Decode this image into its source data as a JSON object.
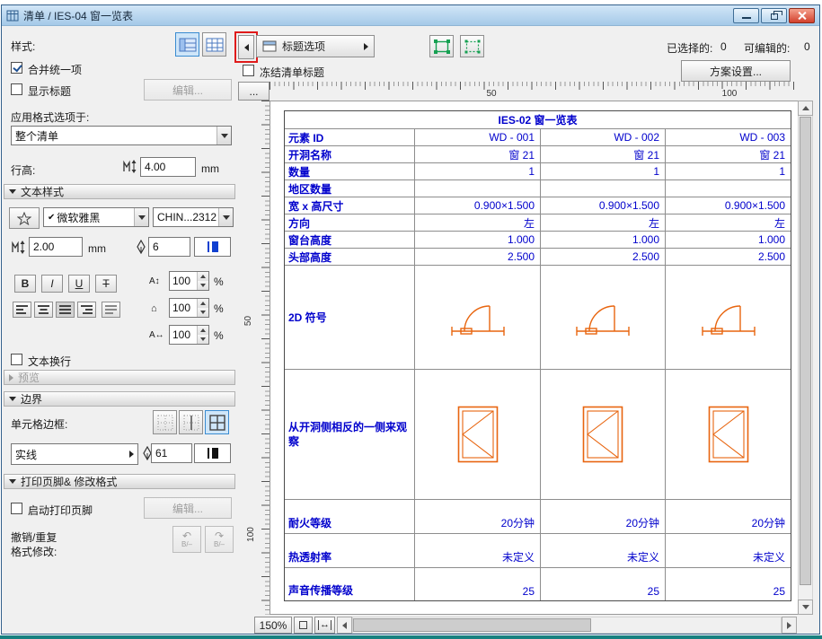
{
  "titlebar": {
    "title": "清单 / IES-04 窗一览表"
  },
  "panel": {
    "style_label": "样式:",
    "merge_uniform": "合并统一项",
    "show_headline": "显示标题",
    "edit": "编辑...",
    "apply_to_label": "应用格式选项于:",
    "apply_to_value": "整个清单",
    "row_height_label": "行高:",
    "row_height_value": "4.00",
    "mm": "mm",
    "sections": {
      "text_style": "文本样式",
      "preview": "预览",
      "border": "边界",
      "print": "打印页脚& 修改格式"
    },
    "font": {
      "check": "✔",
      "name": "微软雅黑",
      "encoding": "CHIN...2312",
      "size": "2.00",
      "pen": "6",
      "bold": "B",
      "italic": "I",
      "underline": "U",
      "strike": "T",
      "line_spacing": "100",
      "width_factor": "100",
      "char_spacing": "100",
      "percent": "%"
    },
    "icons": {
      "line_spacing": "A↕",
      "width_factor": "⌂",
      "char_spacing": "A↔",
      "undo": "↶",
      "redo": "↷",
      "undo_sub": "B/–",
      "redo_sub": "B/–"
    },
    "text_wrap": "文本换行",
    "cell_border_label": "单元格边框:",
    "line_type": "实线",
    "border_pen": "61",
    "enable_print_footer": "启动打印页脚",
    "undo_label": "撤销/重复",
    "format_label": "格式修改:"
  },
  "toolbar": {
    "header_options": "标题选项",
    "selected_label": "已选择的:",
    "selected_value": "0",
    "editable_label": "可编辑的:",
    "editable_value": "0",
    "freeze_header": "冻结清单标题",
    "scheme_settings": "方案设置..."
  },
  "ruler": {
    "corner": "...",
    "h_labels": [
      "50",
      "100"
    ],
    "v_labels": [
      "50",
      "100"
    ]
  },
  "table": {
    "title": "IES-02 窗一览表",
    "rows": [
      {
        "label": "元素 ID",
        "values": [
          "WD - 001",
          "WD - 002",
          "WD - 003"
        ]
      },
      {
        "label": "开洞名称",
        "values": [
          "窗 21",
          "窗 21",
          "窗 21"
        ]
      },
      {
        "label": "数量",
        "values": [
          "1",
          "1",
          "1"
        ]
      },
      {
        "label": "地区数量",
        "values": [
          "",
          "",
          ""
        ]
      },
      {
        "label": "宽 x 高尺寸",
        "values": [
          "0.900×1.500",
          "0.900×1.500",
          "0.900×1.500"
        ]
      },
      {
        "label": "方向",
        "values": [
          "左",
          "左",
          "左"
        ]
      },
      {
        "label": "窗台高度",
        "values": [
          "1.000",
          "1.000",
          "1.000"
        ]
      },
      {
        "label": "头部高度",
        "values": [
          "2.500",
          "2.500",
          "2.500"
        ]
      },
      {
        "label": "2D 符号"
      },
      {
        "label": "从开洞侧相反的一侧来观察"
      },
      {
        "label": "耐火等级",
        "values": [
          "20分钟",
          "20分钟",
          "20分钟"
        ]
      },
      {
        "label": "热透射率",
        "values": [
          "未定义",
          "未定义",
          "未定义"
        ]
      },
      {
        "label": "声音传播等级",
        "values": [
          "25",
          "25",
          "25"
        ]
      }
    ]
  },
  "statusbar": {
    "zoom": "150%",
    "pan_icon": "↔"
  },
  "colors": {
    "table_text": "#0000cc",
    "symbol_orange": "#e8650f",
    "highlight_red": "#e01b1b"
  }
}
